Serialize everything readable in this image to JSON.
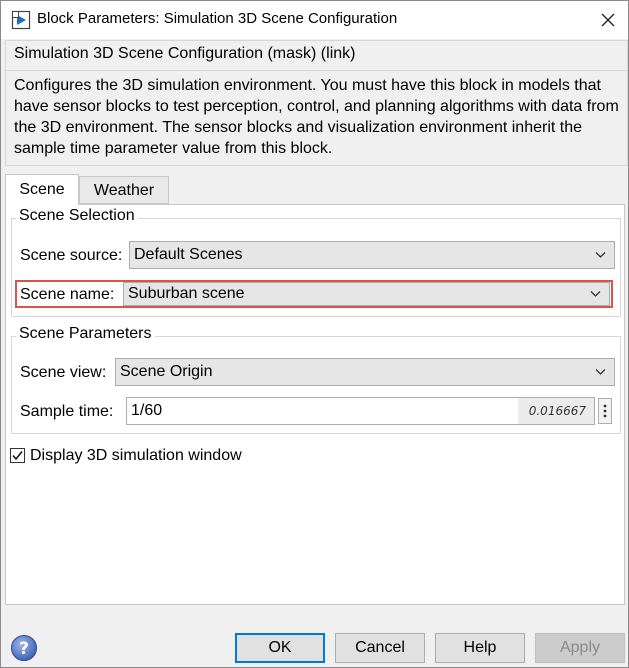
{
  "window": {
    "title": "Block Parameters: Simulation 3D Scene Configuration",
    "app_icon": "simulink-block-icon",
    "close_icon": "close-icon"
  },
  "mask": {
    "header": "Simulation 3D Scene Configuration (mask) (link)",
    "description": "Configures the 3D simulation environment. You must have this block in models that have sensor blocks to test perception, control, and planning algorithms with data from the 3D environment. The sensor blocks and visualization environment inherit the sample time parameter value from this block."
  },
  "tabs": [
    {
      "label": "Scene",
      "active": true
    },
    {
      "label": "Weather",
      "active": false
    }
  ],
  "scene_selection": {
    "title": "Scene Selection",
    "source_label": "Scene source:",
    "source_value": "Default Scenes",
    "name_label": "Scene name:",
    "name_value": "Suburban scene",
    "highlight_color": "#d9534f"
  },
  "scene_parameters": {
    "title": "Scene Parameters",
    "view_label": "Scene view:",
    "view_value": "Scene Origin",
    "sample_time_label": "Sample time:",
    "sample_time_value": "1/60",
    "sample_time_evaluated": "0.016667"
  },
  "display_window": {
    "label": "Display 3D simulation window",
    "checked": true
  },
  "buttons": {
    "ok": "OK",
    "cancel": "Cancel",
    "help": "Help",
    "apply": "Apply",
    "apply_enabled": false,
    "accent_color": "#0078d7"
  },
  "help_icon": "question-icon"
}
